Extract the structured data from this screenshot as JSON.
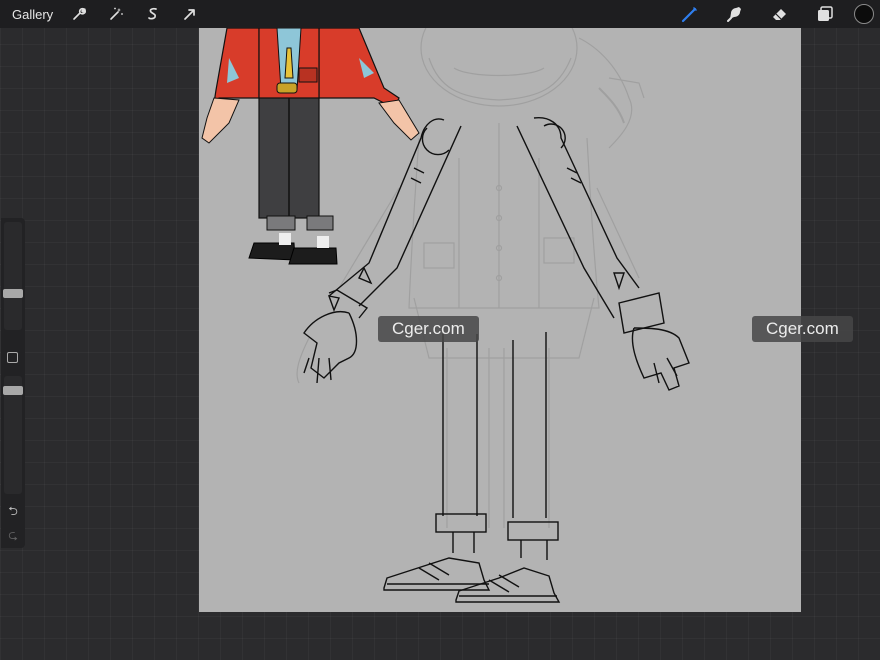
{
  "topbar": {
    "gallery_label": "Gallery",
    "left_tools": [
      "wrench-icon",
      "magic-wand-icon",
      "selection-icon",
      "transform-arrow-icon"
    ],
    "right_tools": [
      "brush-icon",
      "smudge-icon",
      "eraser-icon",
      "layers-icon"
    ],
    "active_tool_color": "#2f7ff0",
    "current_color": "#0c0c0c"
  },
  "sidebar": {
    "brush_size_slider": "size-slider",
    "modify_button": "modify-square",
    "opacity_slider": "opacity-slider",
    "undo_symbol": "⮌",
    "redo_symbol": "⮎"
  },
  "watermarks": [
    "Cger.com",
    "Cger.com"
  ],
  "colors": {
    "canvas_bg": "#b3b3b3",
    "jacket_red": "#d83c2a",
    "shirt_blue": "#8ec6d8",
    "pants_gray": "#4a4a4c",
    "skin": "#f3c4a8"
  }
}
